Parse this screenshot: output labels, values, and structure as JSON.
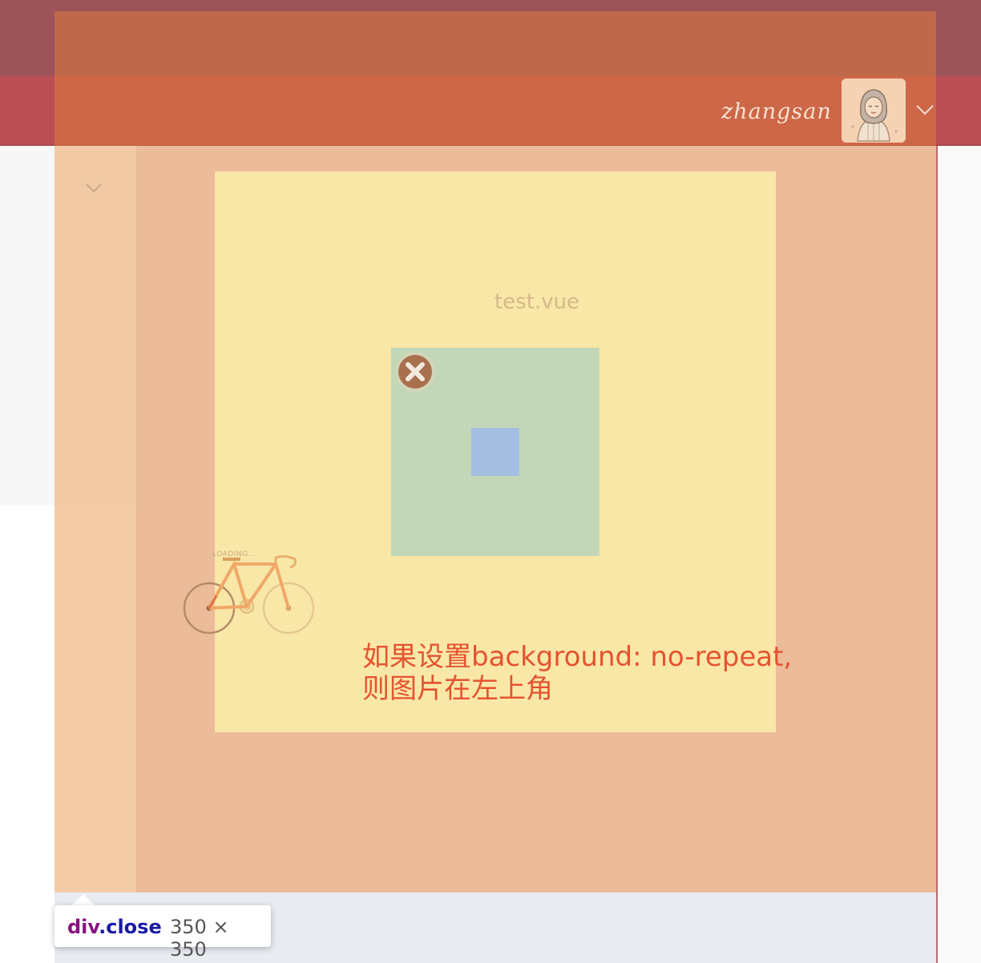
{
  "header": {
    "username": "zhangsan",
    "avatar_icon": "avatar-woman-icon",
    "dropdown_icon": "chevron-down-icon"
  },
  "sidebar": {
    "toggle_icon": "chevron-down-icon"
  },
  "main": {
    "component_label": "test.vue",
    "close_icon": "close-circle-icon",
    "loading_text": "LOADING...",
    "loading_icon": "bicycle-icon",
    "note_line1": "如果设置background: no-repeat,",
    "note_line2": "则图片在左上角"
  },
  "inspector": {
    "tag": "div",
    "class": ".close",
    "size": "350 × 350"
  },
  "colors": {
    "header": "#b94e54",
    "topbar": "#9c535a",
    "overlay": "#e2803c",
    "yellow_box": "#f9e7a8",
    "green_box": "#c2d7b7",
    "blue_box": "#a4bfe2",
    "note_text": "#e5532f"
  }
}
